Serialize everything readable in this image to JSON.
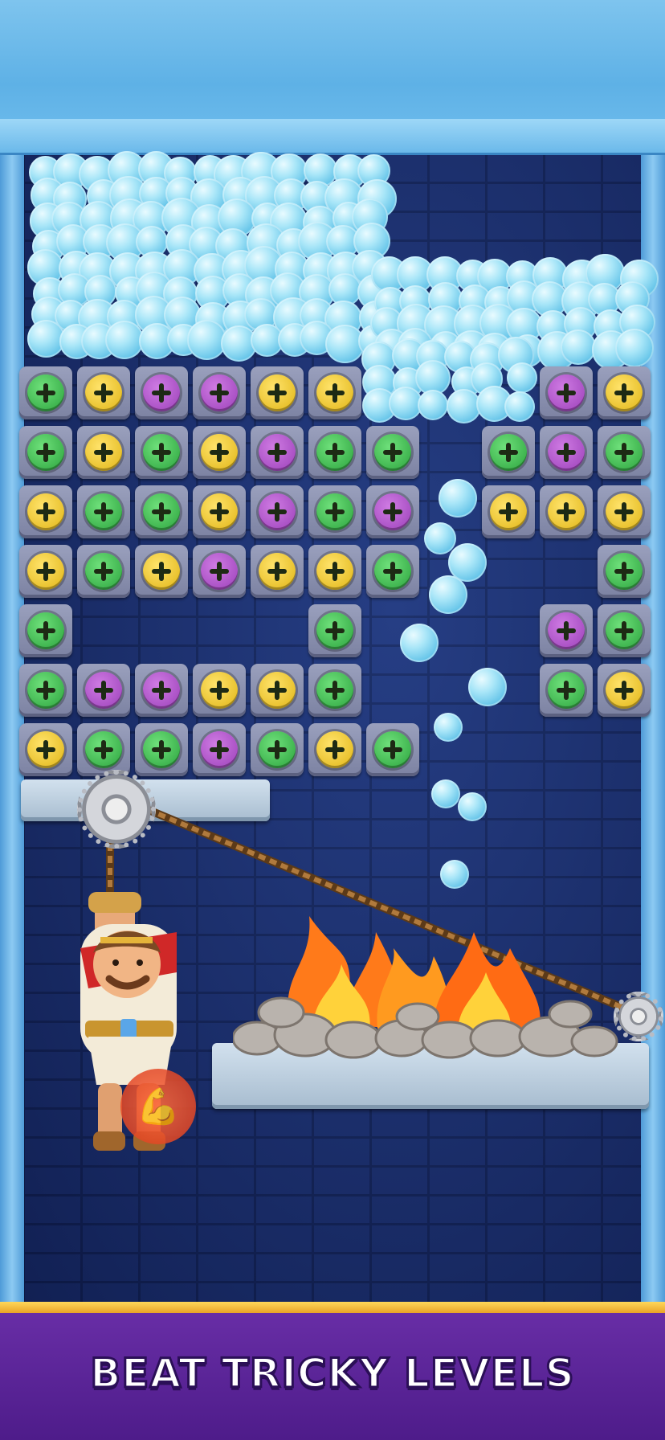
{
  "banner": {
    "text": "BEAT TRICKY LEVELS"
  },
  "colors": {
    "green": "#2aa23c",
    "yellow": "#e0b414",
    "purple": "#9a3fb8",
    "wall": "#1a2f70",
    "banner": "#5a2496"
  },
  "grid": {
    "rows": [
      [
        "green",
        "yellow",
        "purple",
        "purple",
        "yellow",
        "yellow",
        null,
        null,
        null,
        "purple",
        "yellow"
      ],
      [
        "green",
        "yellow",
        "green",
        "yellow",
        "purple",
        "green",
        "green",
        null,
        "green",
        "purple",
        "green"
      ],
      [
        "yellow",
        "green",
        "green",
        "yellow",
        "purple",
        "green",
        "purple",
        null,
        "yellow",
        "yellow",
        "yellow"
      ],
      [
        "yellow",
        "green",
        "yellow",
        "purple",
        "yellow",
        "yellow",
        "green",
        null,
        null,
        null,
        "green"
      ],
      [
        "green",
        null,
        null,
        null,
        null,
        "green",
        null,
        null,
        null,
        "purple",
        "green"
      ],
      [
        "green",
        "purple",
        "purple",
        "yellow",
        "yellow",
        "green",
        null,
        null,
        null,
        "green",
        "yellow"
      ],
      [
        "yellow",
        "green",
        "green",
        "purple",
        "green",
        "yellow",
        "green",
        null,
        null,
        null,
        null
      ]
    ]
  },
  "icons": {
    "strength": "flexed-arm-icon",
    "gear": "gear-icon"
  }
}
